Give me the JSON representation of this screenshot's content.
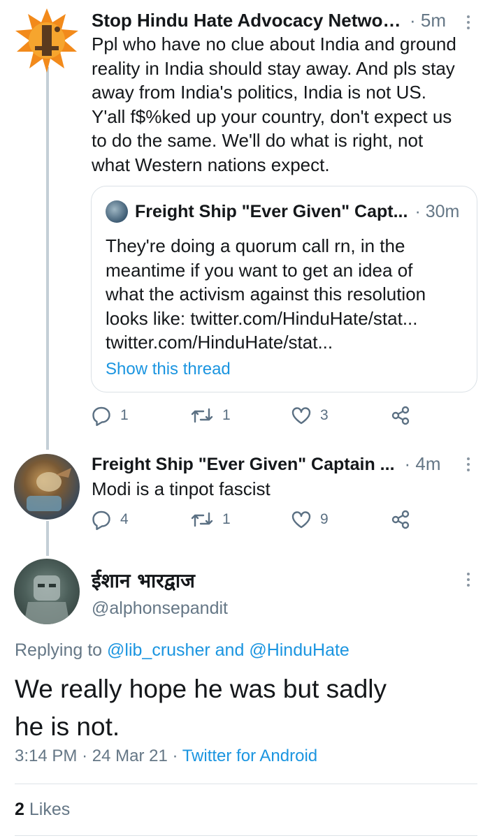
{
  "tweet1": {
    "name": "Stop Hindu Hate Advocacy Networ...",
    "time": "· 5m",
    "text_lines": [
      "Ppl who have no clue about India and ground",
      "reality in India should stay away. And pls stay",
      "away from India's politics, India is not US.",
      "Y'all f$%ked up your country, don't expect us",
      "to do the same. We'll do what is right, not",
      "what Western nations expect."
    ],
    "quote": {
      "name": "Freight Ship \"Ever Given\" Capt...",
      "time": "· 30m",
      "text_lines": [
        "They're doing a quorum call rn, in the",
        "meantime if you want to get an idea of",
        "what the activism against this resolution",
        "looks like: twitter.com/HinduHate/stat...",
        "twitter.com/HinduHate/stat..."
      ],
      "show_thread": "Show this thread"
    },
    "actions": {
      "reply_count": "1",
      "retweet_count": "1",
      "like_count": "3"
    }
  },
  "tweet2": {
    "name": "Freight Ship \"Ever Given\" Captain ...",
    "time": "· 4m",
    "text": "Modi is a tinpot fascist",
    "actions": {
      "reply_count": "4",
      "retweet_count": "1",
      "like_count": "9"
    }
  },
  "main_tweet": {
    "name": "ईशान भारद्वाज",
    "handle": "@alphonsepandit",
    "replying_prefix": "Replying to",
    "replying_user1": "@lib_crusher",
    "replying_and": "and",
    "replying_user2": "@HinduHate",
    "text_lines": [
      "We really hope he was but sadly",
      "he is not."
    ],
    "time": "3:14 PM",
    "sep1": "·",
    "date": "24 Mar 21",
    "sep2": "·",
    "app": "Twitter for Android",
    "likes_count": "2",
    "likes_label": "Likes"
  },
  "colors": {
    "accent": "#1b95e0",
    "secondary_text": "#657786",
    "thread_line": "#c4cfd6"
  },
  "icons": [
    "reply-icon",
    "retweet-icon",
    "like-icon",
    "share-icon",
    "more-icon"
  ]
}
